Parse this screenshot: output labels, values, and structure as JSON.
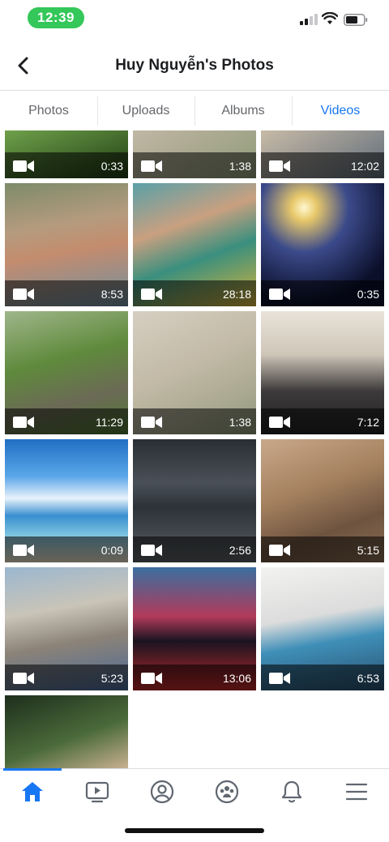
{
  "status_bar": {
    "time": "12:39"
  },
  "header": {
    "title": "Huy Nguyễn's Photos"
  },
  "tabs": [
    {
      "label": "Photos",
      "active": false
    },
    {
      "label": "Uploads",
      "active": false
    },
    {
      "label": "Albums",
      "active": false
    },
    {
      "label": "Videos",
      "active": true
    }
  ],
  "videos": [
    {
      "duration": "0:33",
      "scene": "green leaves"
    },
    {
      "duration": "1:38",
      "scene": "sandy ground"
    },
    {
      "duration": "12:02",
      "scene": "street scene"
    },
    {
      "duration": "8:53",
      "scene": "group in water"
    },
    {
      "duration": "28:18",
      "scene": "group on boat"
    },
    {
      "duration": "0:35",
      "scene": "night lights"
    },
    {
      "duration": "11:29",
      "scene": "hillside group"
    },
    {
      "duration": "1:38",
      "scene": "aerial sand"
    },
    {
      "duration": "7:12",
      "scene": "people indoors"
    },
    {
      "duration": "0:09",
      "scene": "blue sky beach"
    },
    {
      "duration": "2:56",
      "scene": "dark parking garage"
    },
    {
      "duration": "5:15",
      "scene": "piano keys"
    },
    {
      "duration": "5:23",
      "scene": "motorbikes street"
    },
    {
      "duration": "13:06",
      "scene": "stage event"
    },
    {
      "duration": "6:53",
      "scene": "band with guitar"
    },
    {
      "duration": "",
      "scene": "person outdoors"
    }
  ],
  "bottom_nav": [
    {
      "icon": "home-icon",
      "active": true
    },
    {
      "icon": "watch-icon",
      "active": false
    },
    {
      "icon": "profile-icon",
      "active": false
    },
    {
      "icon": "groups-icon",
      "active": false
    },
    {
      "icon": "notifications-icon",
      "active": false
    },
    {
      "icon": "menu-icon",
      "active": false
    }
  ],
  "colors": {
    "accent": "#1877f2",
    "status_green": "#34c759",
    "text_primary": "#1c1e21",
    "text_secondary": "#65676b"
  }
}
